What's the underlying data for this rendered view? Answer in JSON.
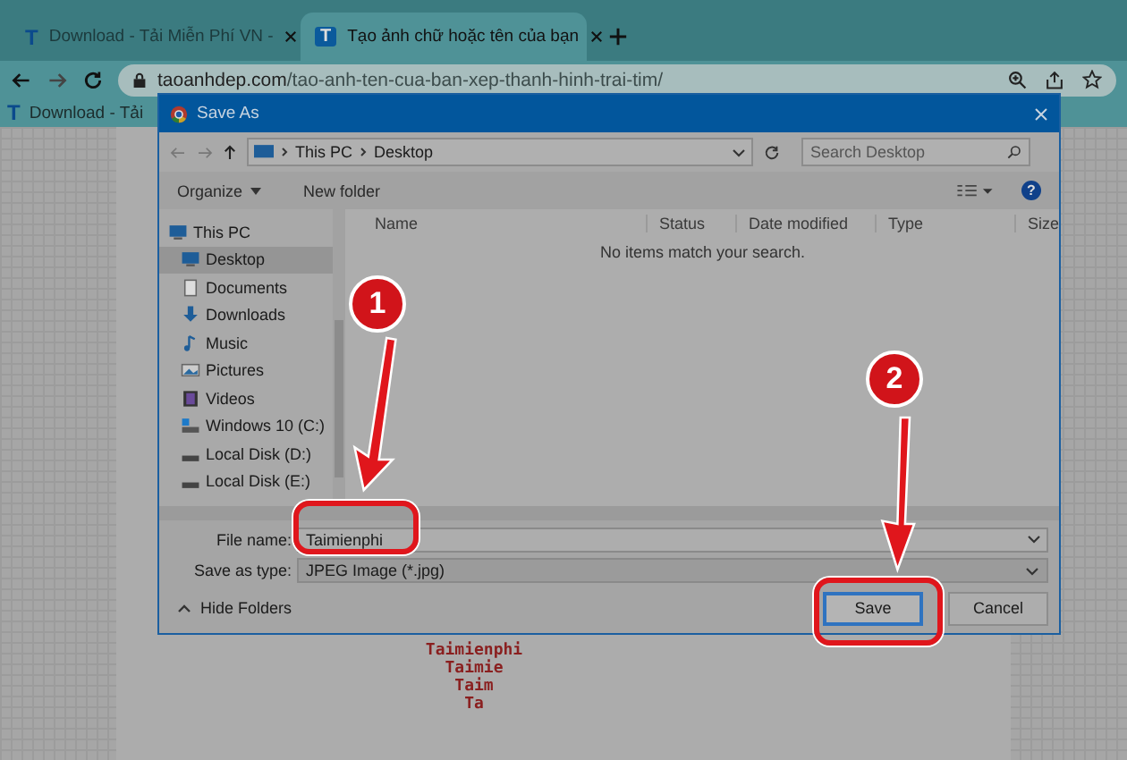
{
  "browser": {
    "tabs": [
      {
        "icon_text": "T",
        "title": "Download - Tải Miễn Phí VN -",
        "selected": false
      },
      {
        "icon_text": "T",
        "title": "Tạo ảnh chữ hoặc tên của bạn",
        "selected": true
      }
    ],
    "url_domain": "taoanhdep.com",
    "url_path": "/tao-anh-ten-cua-ban-xep-thanh-hinh-trai-tim/",
    "bookmarks": [
      {
        "icon_text": "T",
        "label": "Download - Tải"
      }
    ]
  },
  "page": {
    "text_lines": [
      "Taimienphi",
      "Taimie",
      "Taim",
      "Ta"
    ]
  },
  "dialog": {
    "title": "Save As",
    "breadcrumb": [
      "This PC",
      "Desktop"
    ],
    "search": {
      "placeholder": "Search Desktop"
    },
    "toolbar": [
      "Organize",
      "New folder"
    ],
    "help_text": "?",
    "sidebar": [
      {
        "label": "This PC",
        "kind": "pc",
        "selected": false
      },
      {
        "label": "Desktop",
        "kind": "desktop",
        "selected": true
      },
      {
        "label": "Documents",
        "kind": "documents",
        "selected": false
      },
      {
        "label": "Downloads",
        "kind": "downloads",
        "selected": false
      },
      {
        "label": "Music",
        "kind": "music",
        "selected": false
      },
      {
        "label": "Pictures",
        "kind": "pictures",
        "selected": false
      },
      {
        "label": "Videos",
        "kind": "videos",
        "selected": false
      },
      {
        "label": "Windows 10 (C:)",
        "kind": "system-drive",
        "selected": false
      },
      {
        "label": "Local Disk (D:)",
        "kind": "drive",
        "selected": false
      },
      {
        "label": "Local Disk (E:)",
        "kind": "drive",
        "selected": false
      }
    ],
    "columns": [
      "Name",
      "Status",
      "Date modified",
      "Type",
      "Size"
    ],
    "empty_message": "No items match your search.",
    "file_name": {
      "label": "File name:",
      "value": "Taimienphi"
    },
    "save_type": {
      "label": "Save as type:",
      "value": "JPEG Image (*.jpg)"
    },
    "hide_folders": "Hide Folders",
    "buttons": [
      "Save",
      "Cancel"
    ]
  },
  "callouts": [
    "1",
    "2"
  ]
}
